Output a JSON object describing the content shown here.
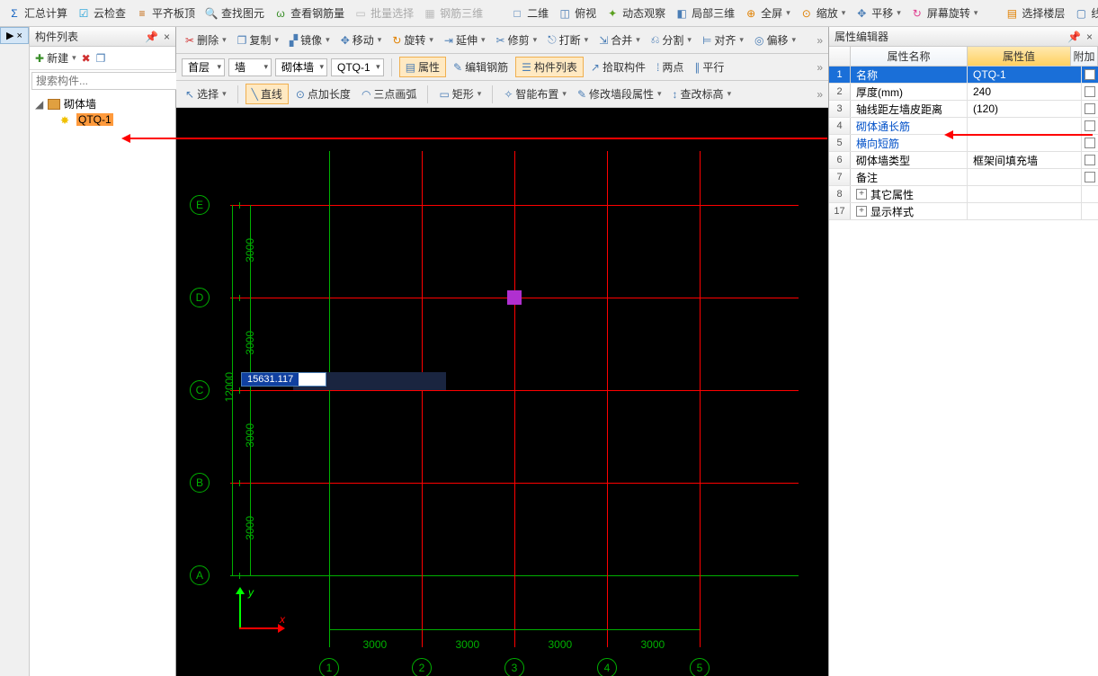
{
  "top_toolbar": {
    "btns": [
      {
        "label": "汇总计算",
        "icon": "Σ",
        "color": "#1060c0"
      },
      {
        "label": "云检查",
        "icon": "☑",
        "color": "#1a9fd8"
      },
      {
        "label": "平齐板顶",
        "icon": "≡",
        "color": "#c06000"
      },
      {
        "label": "查找图元",
        "icon": "🔍",
        "color": "#d07000"
      },
      {
        "label": "查看钢筋量",
        "icon": "ω",
        "color": "#3a8f2a"
      },
      {
        "label": "批量选择",
        "icon": "▭",
        "color": "#bbb",
        "disabled": true
      },
      {
        "label": "钢筋三维",
        "icon": "▦",
        "color": "#bbb",
        "disabled": true
      },
      {
        "label": "二维",
        "icon": "□",
        "color": "#4a7db5"
      },
      {
        "label": "俯视",
        "icon": "◫",
        "color": "#4a7db5"
      },
      {
        "label": "动态观察",
        "icon": "✦",
        "color": "#5aa020"
      },
      {
        "label": "局部三维",
        "icon": "◧",
        "color": "#4a7db5"
      },
      {
        "label": "全屏",
        "icon": "⊕",
        "color": "#e08000"
      },
      {
        "label": "缩放",
        "icon": "⊙",
        "color": "#e08000"
      },
      {
        "label": "平移",
        "icon": "✥",
        "color": "#4a7db5"
      },
      {
        "label": "屏幕旋转",
        "icon": "↻",
        "color": "#e04090"
      },
      {
        "label": "选择楼层",
        "icon": "▤",
        "color": "#e08000"
      },
      {
        "label": "线框",
        "icon": "▢",
        "color": "#4a7db5"
      }
    ]
  },
  "left_tab": "▶ ×",
  "comp_panel": {
    "title": "构件列表",
    "new_label": "新建",
    "search_placeholder": "搜索构件...",
    "tree": {
      "parent": "砌体墙",
      "child": "QTQ-1"
    }
  },
  "center_toolbars": {
    "row1": [
      {
        "t": "btn",
        "label": "删除",
        "icon": "✂",
        "color": "#d03030"
      },
      {
        "t": "btn",
        "label": "复制",
        "icon": "❐",
        "color": "#4a7db5"
      },
      {
        "t": "btn",
        "label": "镜像",
        "icon": "▞",
        "color": "#4a7db5"
      },
      {
        "t": "btn",
        "label": "移动",
        "icon": "✥",
        "color": "#4a7db5"
      },
      {
        "t": "btn",
        "label": "旋转",
        "icon": "↻",
        "color": "#e08000"
      },
      {
        "t": "btn",
        "label": "延伸",
        "icon": "⇥",
        "color": "#4a7db5"
      },
      {
        "t": "btn",
        "label": "修剪",
        "icon": "✂",
        "color": "#4a7db5"
      },
      {
        "t": "btn",
        "label": "打断",
        "icon": "⎋",
        "color": "#4a7db5"
      },
      {
        "t": "btn",
        "label": "合并",
        "icon": "⇲",
        "color": "#4a7db5"
      },
      {
        "t": "btn",
        "label": "分割",
        "icon": "⎌",
        "color": "#4a7db5"
      },
      {
        "t": "btn",
        "label": "对齐",
        "icon": "⊨",
        "color": "#4a7db5"
      },
      {
        "t": "btn",
        "label": "偏移",
        "icon": "◎",
        "color": "#4a7db5"
      }
    ],
    "row2": {
      "sel1": "首层",
      "sel2": "墙",
      "sel3": "砌体墙",
      "sel4": "QTQ-1",
      "btns": [
        {
          "label": "属性",
          "icon": "▤",
          "boxed": true
        },
        {
          "label": "编辑钢筋",
          "icon": "✎"
        },
        {
          "label": "构件列表",
          "icon": "☰",
          "boxed": true
        },
        {
          "label": "拾取构件",
          "icon": "↗"
        },
        {
          "label": "两点",
          "icon": "⁞"
        },
        {
          "label": "平行",
          "icon": "∥"
        }
      ]
    },
    "row3": {
      "sel_label": "选择",
      "btns": [
        {
          "label": "直线",
          "icon": "╲",
          "boxed": true
        },
        {
          "label": "点加长度",
          "icon": "⊙"
        },
        {
          "label": "三点画弧",
          "icon": "◠"
        },
        {
          "label": "矩形",
          "icon": "▭"
        },
        {
          "label": "智能布置",
          "icon": "✧"
        },
        {
          "label": "修改墙段属性",
          "icon": "✎"
        },
        {
          "label": "查改标高",
          "icon": "↕"
        }
      ]
    }
  },
  "canvas": {
    "rows": [
      "E",
      "D",
      "C",
      "B",
      "A"
    ],
    "cols": [
      "1",
      "2",
      "3",
      "4",
      "5"
    ],
    "h_dims": [
      "3000",
      "3000",
      "3000",
      "3000"
    ],
    "v_dims": [
      "3000",
      "3000",
      "3000",
      "3000"
    ],
    "v_total": "12000",
    "input_value": "15631.117",
    "xy": {
      "x": "x",
      "y": "y"
    }
  },
  "prop_panel": {
    "title": "属性编辑器",
    "col_name": "属性名称",
    "col_value": "属性值",
    "col_add": "附加",
    "rows": [
      {
        "idx": "1",
        "name": "名称",
        "value": "QTQ-1",
        "sel": true
      },
      {
        "idx": "2",
        "name": "厚度(mm)",
        "value": "240"
      },
      {
        "idx": "3",
        "name": "轴线距左墙皮距离",
        "value": "(120)"
      },
      {
        "idx": "4",
        "name": "砌体通长筋",
        "value": "",
        "blue": true
      },
      {
        "idx": "5",
        "name": "横向短筋",
        "value": "",
        "blue": true
      },
      {
        "idx": "6",
        "name": "砌体墙类型",
        "value": "框架间填充墙"
      },
      {
        "idx": "7",
        "name": "备注",
        "value": ""
      },
      {
        "idx": "8",
        "name": "其它属性",
        "value": "",
        "exp": true
      },
      {
        "idx": "17",
        "name": "显示样式",
        "value": "",
        "exp": true
      }
    ]
  }
}
